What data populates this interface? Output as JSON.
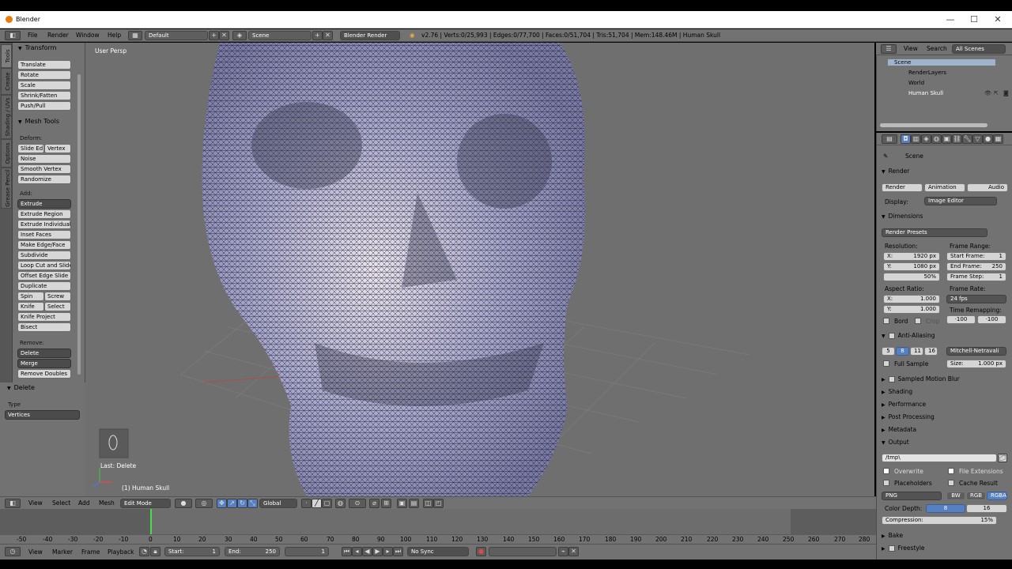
{
  "window": {
    "title": "Blender",
    "minimize": "—",
    "maximize": "☐",
    "close": "✕"
  },
  "topbar": {
    "menus": [
      "File",
      "Render",
      "Window",
      "Help"
    ],
    "layout": "Default",
    "scene": "Scene",
    "engine": "Blender Render",
    "stats": "v2.76 | Verts:0/25,993 | Edges:0/77,700 | Faces:0/51,704 | Tris:51,704 | Mem:148.46M | Human Skull"
  },
  "tool_tabs": [
    "Tools",
    "Create",
    "Shading / UVs",
    "Options",
    "Grease Pencil"
  ],
  "toolshelf": {
    "transform_header": "Transform",
    "transform": [
      "Translate",
      "Rotate",
      "Scale",
      "Shrink/Fatten",
      "Push/Pull"
    ],
    "mesh_tools_header": "Mesh Tools",
    "deform_label": "Deform:",
    "slide_edge": "Slide Ed",
    "vertex": "Vertex",
    "deform": [
      "Noise",
      "Smooth Vertex",
      "Randomize"
    ],
    "add_label": "Add:",
    "extrude": "Extrude",
    "add": [
      "Extrude Region",
      "Extrude Individual",
      "Inset Faces",
      "Make Edge/Face",
      "Subdivide",
      "Loop Cut and Slide",
      "Offset Edge Slide",
      "Duplicate"
    ],
    "spin": "Spin",
    "screw": "Screw",
    "knife": "Knife",
    "select": "Select",
    "knife_project": "Knife Project",
    "bisect": "Bisect",
    "remove_label": "Remove:",
    "delete": "Delete",
    "merge": "Merge",
    "remove_doubles": "Remove Doubles",
    "op_header": "Delete",
    "op_type_label": "Type",
    "op_type_value": "Vertices"
  },
  "viewport": {
    "persp_label": "User Persp",
    "last_op": "Last: Delete",
    "object_label": "(1) Human Skull"
  },
  "viewport_header": {
    "menus": [
      "View",
      "Select",
      "Add",
      "Mesh"
    ],
    "mode": "Edit Mode",
    "orientation": "Global"
  },
  "timeline": {
    "ticks": [
      "-50",
      "-40",
      "-30",
      "-20",
      "-10",
      "0",
      "10",
      "20",
      "30",
      "40",
      "50",
      "60",
      "70",
      "80",
      "90",
      "100",
      "110",
      "120",
      "130",
      "140",
      "150",
      "160",
      "170",
      "180",
      "190",
      "200",
      "210",
      "220",
      "230",
      "240",
      "250",
      "260",
      "270",
      "280"
    ],
    "menus": [
      "View",
      "Marker",
      "Frame",
      "Playback"
    ],
    "start_label": "Start:",
    "start_value": "1",
    "end_label": "End:",
    "end_value": "250",
    "current": "1",
    "sync": "No Sync"
  },
  "outliner": {
    "menus": [
      "View",
      "Search"
    ],
    "filter": "All Scenes",
    "items": [
      "Scene",
      "RenderLayers",
      "World",
      "Human Skull"
    ]
  },
  "properties": {
    "context": "Scene",
    "render_header": "Render",
    "render_btn": "Render",
    "animation_btn": "Animation",
    "audio_btn": "Audio",
    "display_label": "Display:",
    "display_value": "Image Editor",
    "dimensions_header": "Dimensions",
    "render_presets": "Render Presets",
    "resolution_label": "Resolution:",
    "res_x": "1920 px",
    "res_y": "1080 px",
    "res_pct": "50%",
    "frame_range_label": "Frame Range:",
    "start_frame": "1",
    "end_frame": "250",
    "frame_step": "1",
    "start_frame_label": "Start Frame:",
    "end_frame_label": "End Frame:",
    "frame_step_label": "Frame Step:",
    "aspect_label": "Aspect Ratio:",
    "aspect_x": "1.000",
    "aspect_y": "1.000",
    "frame_rate_label": "Frame Rate:",
    "frame_rate": "24 fps",
    "time_remap_label": "Time Remapping:",
    "remap_old": "·100",
    "remap_new": "·100",
    "bord": "Bord",
    "crop": "Crop",
    "aa_header": "Anti-Aliasing",
    "aa_samples": [
      "5",
      "8",
      "11",
      "16"
    ],
    "aa_filter": "Mitchell-Netravali",
    "full_sample": "Full Sample",
    "aa_size_label": "Size:",
    "aa_size": "1.000 px",
    "collapsed": [
      "Sampled Motion Blur",
      "Shading",
      "Performance",
      "Post Processing",
      "Metadata"
    ],
    "output_header": "Output",
    "output_path": "/tmp\\",
    "overwrite": "Overwrite",
    "file_extensions": "File Extensions",
    "placeholders": "Placeholders",
    "cache_result": "Cache Result",
    "format": "PNG",
    "bw": "BW",
    "rgb": "RGB",
    "rgba": "RGBA",
    "color_depth_label": "Color Depth:",
    "depth_8": "8",
    "depth_16": "16",
    "compression_label": "Compression:",
    "compression": "15%",
    "bake_header": "Bake",
    "freestyle_header": "Freestyle"
  },
  "colors": {
    "accent_blue": "#5680c2",
    "timeline_green": "#4ed84e",
    "ui_gray": "#727272"
  }
}
